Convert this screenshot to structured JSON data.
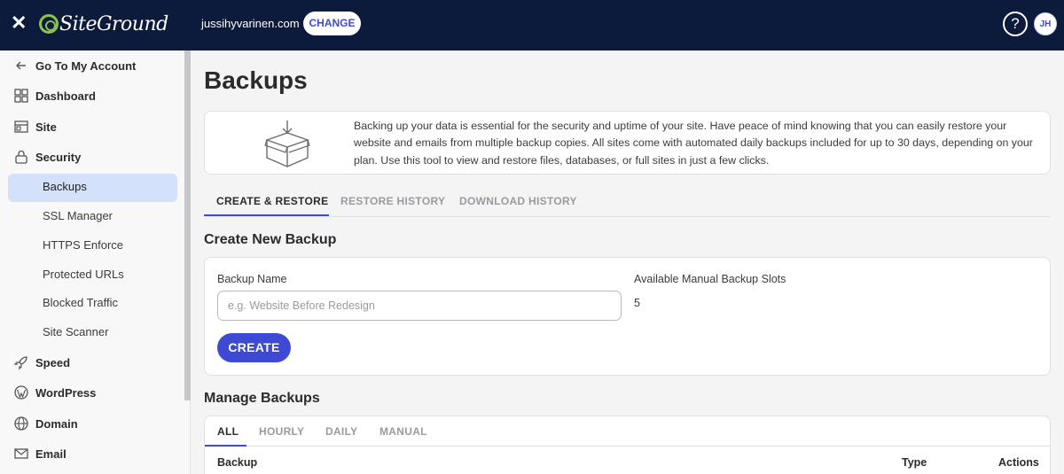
{
  "topbar": {
    "logo_text": "SiteGround",
    "domain": "jussihyvarinen.com",
    "change_label": "CHANGE",
    "help_label": "?",
    "avatar_initials": "JH"
  },
  "sidebar": {
    "go_to_account": "Go To My Account",
    "items": {
      "dashboard": "Dashboard",
      "site": "Site",
      "security": "Security",
      "speed": "Speed",
      "wordpress": "WordPress",
      "domain": "Domain",
      "email": "Email"
    },
    "security_sub": {
      "backups": "Backups",
      "ssl": "SSL Manager",
      "https": "HTTPS Enforce",
      "protected": "Protected URLs",
      "blocked": "Blocked Traffic",
      "scanner": "Site Scanner"
    }
  },
  "main": {
    "title": "Backups",
    "info_text": "Backing up your data is essential for the security and uptime of your site. Have peace of mind knowing that you can easily restore your website and emails from multiple backup copies. All sites come with automated daily backups included for up to 30 days, depending on your plan. Use this tool to view and restore files, databases, or full sites in just a few clicks.",
    "tabs": {
      "create_restore": "CREATE & RESTORE",
      "restore_history": "RESTORE HISTORY",
      "download_history": "DOWNLOAD HISTORY"
    },
    "create_section": {
      "heading": "Create New Backup",
      "name_label": "Backup Name",
      "name_placeholder": "e.g. Website Before Redesign",
      "slots_label": "Available Manual Backup Slots",
      "slots_value": "5",
      "create_label": "CREATE"
    },
    "manage_section": {
      "heading": "Manage Backups",
      "tabs": {
        "all": "ALL",
        "hourly": "HOURLY",
        "daily": "DAILY",
        "manual": "MANUAL"
      },
      "columns": {
        "backup": "Backup",
        "type": "Type",
        "actions": "Actions"
      }
    }
  },
  "colors": {
    "topbar_bg": "#0c1a3c",
    "accent": "#3e4ad4",
    "logo_green": "#8bc34a",
    "sidebar_active": "#d4e1fa"
  }
}
